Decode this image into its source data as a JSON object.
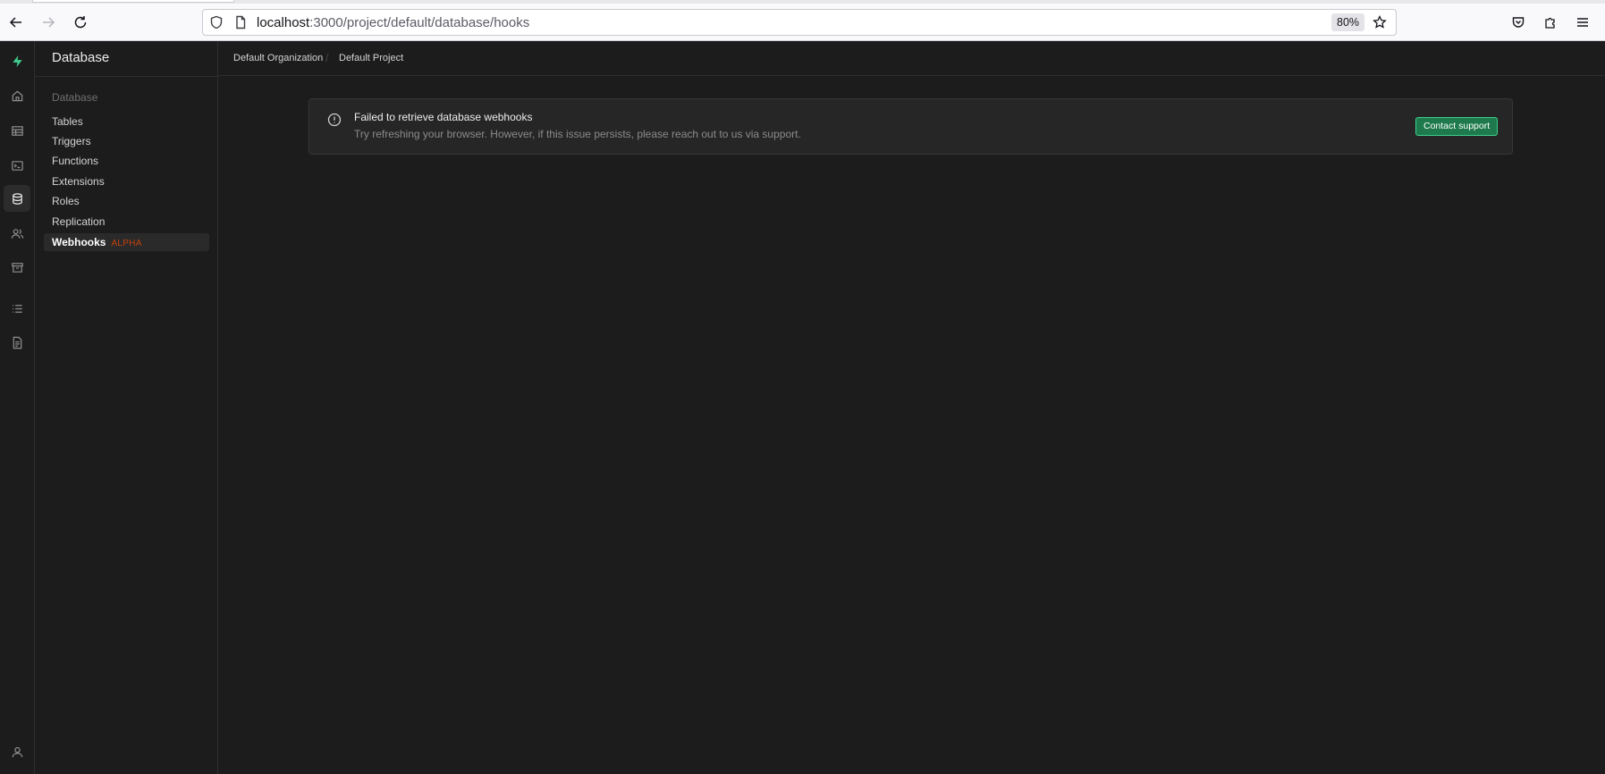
{
  "browser": {
    "url_host": "localhost",
    "url_path": ":3000/project/default/database/hooks",
    "zoom": "80%"
  },
  "sidebar": {
    "title": "Database",
    "section": "Database",
    "items": [
      {
        "label": "Tables"
      },
      {
        "label": "Triggers"
      },
      {
        "label": "Functions"
      },
      {
        "label": "Extensions"
      },
      {
        "label": "Roles"
      },
      {
        "label": "Replication"
      },
      {
        "label": "Webhooks",
        "badge": "ALPHA",
        "active": true
      }
    ]
  },
  "breadcrumb": {
    "organization": "Default Organization",
    "project": "Default Project"
  },
  "alert": {
    "title": "Failed to retrieve database webhooks",
    "description": "Try refreshing your browser. However, if this issue persists, please reach out to us via support.",
    "button": "Contact support"
  },
  "rail_icons": [
    "logo-icon",
    "home-icon",
    "table-editor-icon",
    "sql-editor-icon",
    "database-icon",
    "auth-users-icon",
    "storage-icon",
    "logs-icon",
    "reports-icon",
    "account-icon"
  ],
  "colors": {
    "brand": "#3ecf8e",
    "button_bg": "#1e7a4c",
    "badge": "#c2410c",
    "background": "#1c1c1c"
  }
}
